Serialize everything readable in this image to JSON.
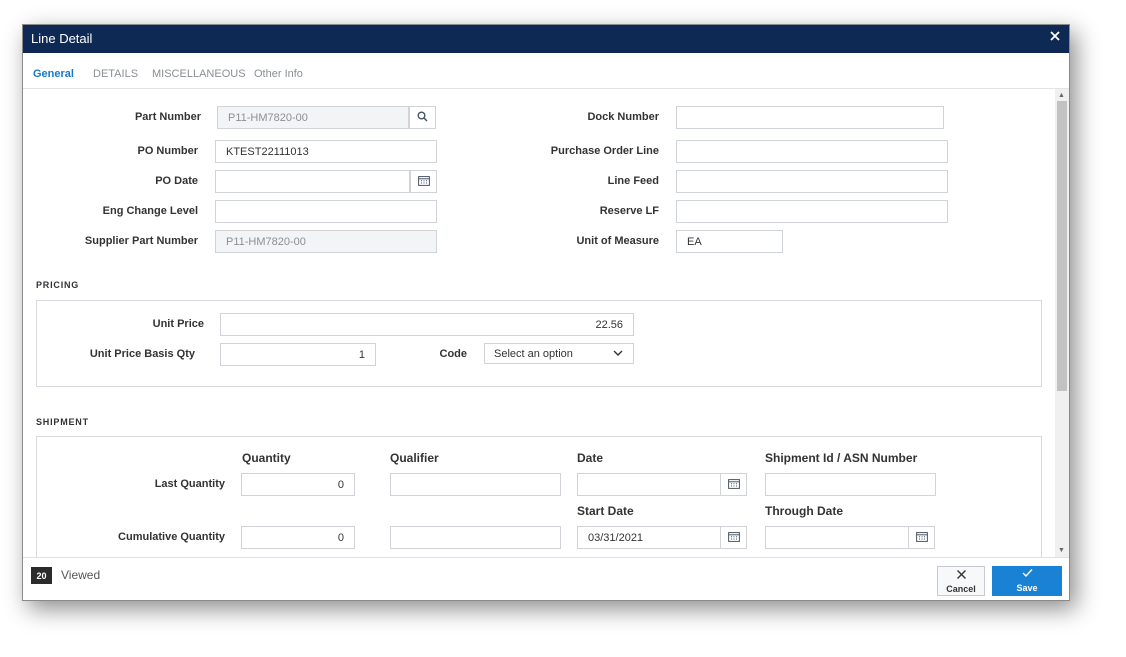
{
  "dialog": {
    "title": "Line Detail"
  },
  "tabs": [
    {
      "label": "General",
      "active": true
    },
    {
      "label": "DETAILS"
    },
    {
      "label": "MISCELLANEOUS"
    },
    {
      "label": "Other Info"
    }
  ],
  "fields": {
    "part_number": {
      "label": "Part Number",
      "value": "P11-HM7820-00"
    },
    "po_number": {
      "label": "PO Number",
      "value": "KTEST22111013"
    },
    "po_date": {
      "label": "PO Date",
      "value": ""
    },
    "eng_change_level": {
      "label": "Eng Change Level",
      "value": ""
    },
    "supplier_part_number": {
      "label": "Supplier Part Number",
      "value": "P11-HM7820-00"
    },
    "dock_number": {
      "label": "Dock Number",
      "value": ""
    },
    "purchase_order_line": {
      "label": "Purchase Order Line",
      "value": ""
    },
    "line_feed": {
      "label": "Line Feed",
      "value": ""
    },
    "reserve_lf": {
      "label": "Reserve LF",
      "value": ""
    },
    "unit_of_measure": {
      "label": "Unit of Measure",
      "value": "EA"
    }
  },
  "pricing": {
    "title": "PRICING",
    "unit_price": {
      "label": "Unit Price",
      "value": "22.56"
    },
    "unit_price_basis_qty": {
      "label": "Unit Price Basis Qty",
      "value": "1"
    },
    "code": {
      "label": "Code",
      "value": "Select an option"
    }
  },
  "shipment": {
    "title": "SHIPMENT",
    "col_quantity": "Quantity",
    "col_qualifier": "Qualifier",
    "col_date": "Date",
    "col_shipment_id": "Shipment Id / ASN Number",
    "last_quantity": {
      "label": "Last Quantity",
      "quantity": "0",
      "qualifier": "",
      "date": "",
      "shipment_id": ""
    },
    "start_date_label": "Start Date",
    "through_date_label": "Through Date",
    "cumulative_quantity": {
      "label": "Cumulative Quantity",
      "quantity": "0",
      "qualifier": "",
      "start_date": "03/31/2021",
      "through_date": ""
    }
  },
  "footer": {
    "count": "20",
    "viewed": "Viewed",
    "cancel_label": "Cancel",
    "save_label": "Save"
  },
  "colors": {
    "titlebar": "#0e2a54",
    "accent": "#1a82d4",
    "active_tab": "#1679c7"
  },
  "icons": {
    "search": "search-icon",
    "calendar": "calendar-icon",
    "close": "close-icon",
    "chevron": "chevron-down-icon",
    "check": "check-icon"
  }
}
